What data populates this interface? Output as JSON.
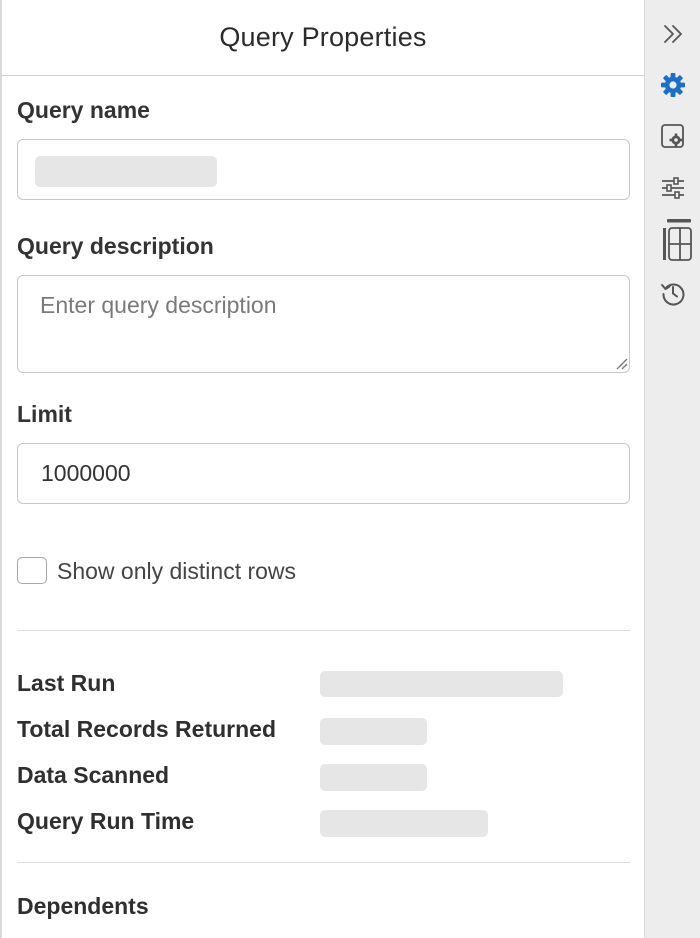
{
  "panel": {
    "title": "Query Properties"
  },
  "form": {
    "name_label": "Query name",
    "name_value": "",
    "description_label": "Query description",
    "description_placeholder": "Enter query description",
    "limit_label": "Limit",
    "limit_value": "1000000",
    "distinct_label": "Show only distinct rows",
    "distinct_checked": false
  },
  "stats": {
    "last_run_label": "Last Run",
    "total_records_label": "Total Records Returned",
    "data_scanned_label": "Data Scanned",
    "run_time_label": "Query Run Time"
  },
  "dependents": {
    "label": "Dependents"
  },
  "sidebar": {
    "icons": [
      "collapse-icon",
      "gear-icon",
      "settings-panel-icon",
      "sliders-icon",
      "table-layout-icon",
      "history-icon"
    ],
    "active": "gear-icon",
    "active_color": "#1a6fc9"
  }
}
